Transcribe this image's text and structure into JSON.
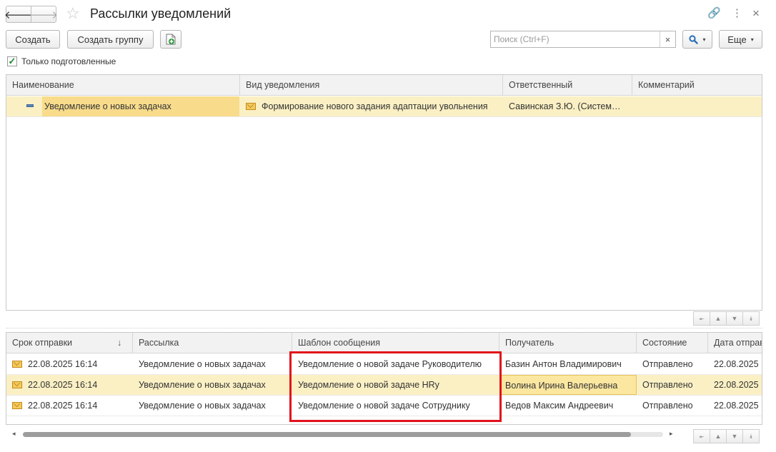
{
  "window": {
    "title": "Рассылки уведомлений",
    "back_icon": "arrow-left-icon",
    "forward_icon": "arrow-right-icon",
    "favorite_icon": "star-icon",
    "link_icon": "link-icon",
    "more_icon": "vertical-dots-icon",
    "close_icon": "close-icon",
    "back_glyph": "🡐",
    "forward_glyph": "🡒",
    "star_glyph": "☆",
    "link_glyph": "🔗",
    "more_glyph": "⋮",
    "close_glyph": "×"
  },
  "toolbar": {
    "create_label": "Создать",
    "create_group_label": "Создать группу",
    "search_placeholder": "Поиск (Ctrl+F)",
    "search_value": "",
    "clear_glyph": "×",
    "search_glyph": "🔍",
    "more_label": "Еще",
    "caret_glyph": "▾"
  },
  "filter": {
    "only_prepared_label": "Только подготовленные",
    "only_prepared_checked": true,
    "check_glyph": "✓"
  },
  "top_table": {
    "columns": [
      "Наименование",
      "Вид уведомления",
      "Ответственный",
      "Комментарий"
    ],
    "rows": [
      {
        "name": "Уведомление о новых задачах",
        "type": "Формирование нового задания адаптации увольнения",
        "responsible": "Савинская З.Ю. (Систем…",
        "comment": ""
      }
    ]
  },
  "bottom_table": {
    "columns": [
      "Срок отправки",
      "Рассылка",
      "Шаблон сообщения",
      "Получатель",
      "Состояние",
      "Дата отправ"
    ],
    "sort_glyph": "↓",
    "rows": [
      {
        "deadline": "22.08.2025 16:14",
        "mailing": "Уведомление о новых задачах",
        "template": "Уведомление о новой задаче Руководителю",
        "recipient": "Базин Антон Владимирович",
        "status": "Отправлено",
        "sent_date": "22.08.2025"
      },
      {
        "deadline": "22.08.2025 16:14",
        "mailing": "Уведомление о новых задачах",
        "template": "Уведомление о новой задаче HRу",
        "recipient": "Волина Ирина Валерьевна",
        "status": "Отправлено",
        "sent_date": "22.08.2025"
      },
      {
        "deadline": "22.08.2025 16:14",
        "mailing": "Уведомление о новых задачах",
        "template": "Уведомление о новой задаче Сотруднику",
        "recipient": "Ведов Максим Андреевич",
        "status": "Отправлено",
        "sent_date": "22.08.2025"
      }
    ]
  },
  "nav_buttons": {
    "first_glyph": "⯬",
    "up_glyph": "▲",
    "down_glyph": "▼",
    "last_glyph": "⯯"
  },
  "scrollbar": {
    "left_glyph": "◂",
    "right_glyph": "▸",
    "position": 0.95
  },
  "colors": {
    "selection": "#fbf0c4",
    "current_cell": "#f8dc8b",
    "highlight_border": "#e0121b",
    "check": "#1d8a2c"
  }
}
